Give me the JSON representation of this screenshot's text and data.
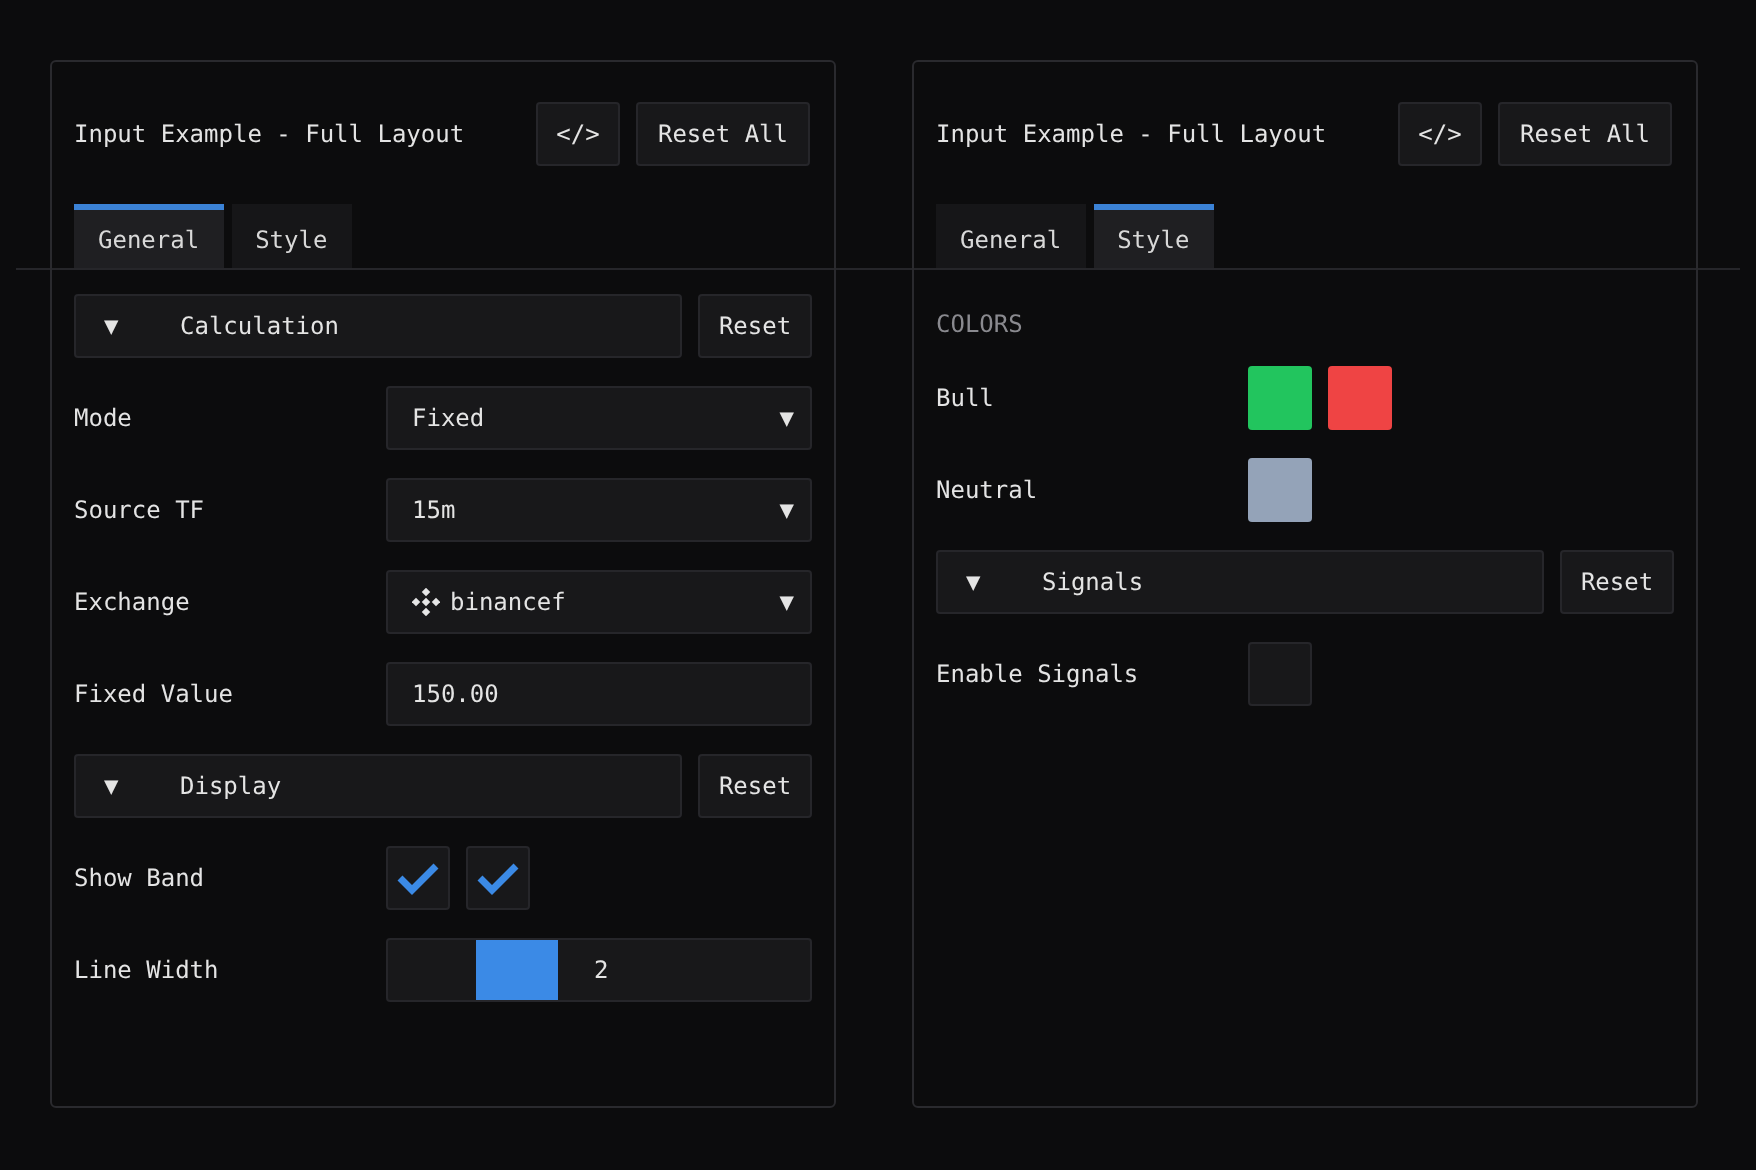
{
  "panels": [
    {
      "title": "Input Example - Full Layout",
      "code_button": "</>",
      "reset_all": "Reset All",
      "tabs": [
        {
          "label": "General",
          "selected": true
        },
        {
          "label": "Style",
          "selected": false
        }
      ],
      "rows": [
        {
          "kind": "section",
          "arrow": "▼",
          "title": "Calculation",
          "reset": "Reset"
        },
        {
          "kind": "select",
          "label": "Mode",
          "value": "Fixed",
          "arrow": "▼"
        },
        {
          "kind": "select",
          "label": "Source TF",
          "value": "15m",
          "arrow": "▼"
        },
        {
          "kind": "select",
          "label": "Exchange",
          "value": "binancef",
          "arrow": "▼",
          "has_icon": true
        },
        {
          "kind": "number",
          "label": "Fixed Value",
          "value": "150.00"
        },
        {
          "kind": "section",
          "arrow": "▼",
          "title": "Display",
          "reset": "Reset"
        },
        {
          "kind": "checkboxes",
          "label": "Show Band",
          "boxes": [
            {
              "checked": true
            },
            {
              "checked": true
            }
          ]
        },
        {
          "kind": "slider",
          "label": "Line Width",
          "value": "2"
        }
      ]
    },
    {
      "title": "Input Example - Full Layout",
      "code_button": "</>",
      "reset_all": "Reset All",
      "tabs": [
        {
          "label": "General",
          "selected": false
        },
        {
          "label": "Style",
          "selected": true
        }
      ],
      "rows": [
        {
          "kind": "heading",
          "title": "COLORS"
        },
        {
          "kind": "colors",
          "label": "Bull",
          "swatches": [
            {
              "color": "#22c55e"
            },
            {
              "color": "#ef4444"
            }
          ]
        },
        {
          "kind": "colors",
          "label": "Neutral",
          "swatches": [
            {
              "color": "#94a3b8"
            }
          ]
        },
        {
          "kind": "section",
          "arrow": "▼",
          "title": "Signals",
          "reset": "Reset"
        },
        {
          "kind": "checkboxes",
          "label": "Enable Signals",
          "boxes": [
            {
              "checked": false
            }
          ]
        }
      ]
    }
  ]
}
